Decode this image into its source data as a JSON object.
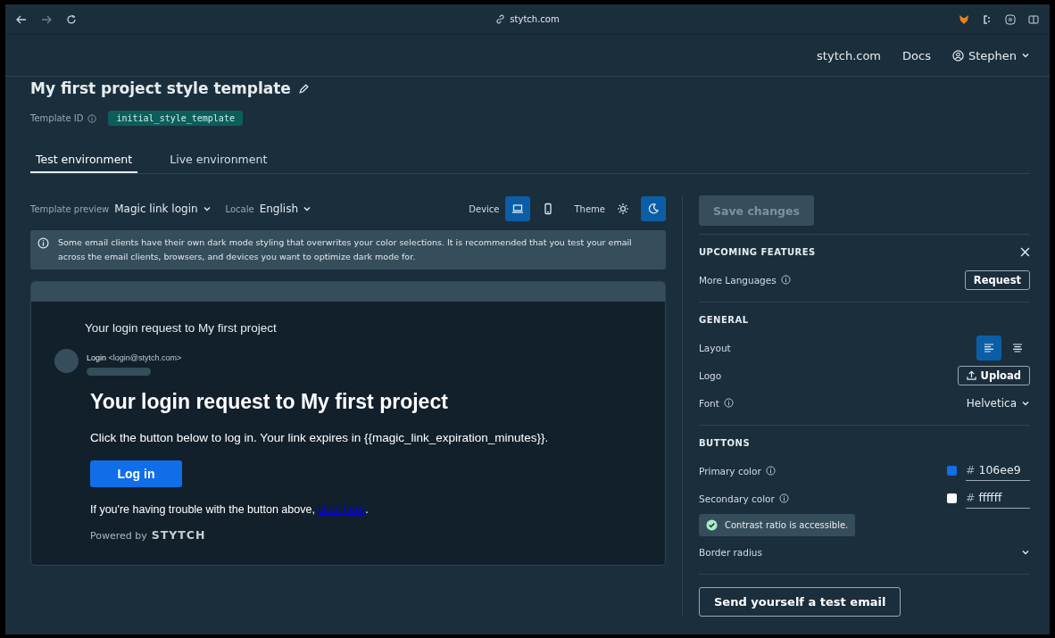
{
  "browser": {
    "url": "stytch.com"
  },
  "nav": {
    "links": [
      "stytch.com",
      "Docs"
    ],
    "user": "Stephen"
  },
  "title": "My first project style template",
  "template_id": {
    "label": "Template ID",
    "value": "initial_style_template"
  },
  "tabs": [
    {
      "label": "Test environment",
      "selected": true
    },
    {
      "label": "Live environment",
      "selected": false
    }
  ],
  "preview": {
    "template_label": "Template preview",
    "template_value": "Magic link login",
    "locale_label": "Locale",
    "locale_value": "English",
    "device_label": "Device",
    "devices": [
      {
        "kind": "laptop",
        "selected": true
      },
      {
        "kind": "phone",
        "selected": false
      }
    ],
    "theme_label": "Theme",
    "themes": [
      {
        "kind": "light",
        "selected": false
      },
      {
        "kind": "dark",
        "selected": true
      }
    ]
  },
  "notice": "Some email clients have their own dark mode styling that overwrites your color selections. It is recommended that you test your email across the email clients, browsers, and devices you want to optimize dark mode for.",
  "email": {
    "subject": "Your login request to My first project",
    "sender_name": "Login",
    "sender_email": "<login@stytch.com>",
    "heading": "Your login request to My first project",
    "body": "Click the button below to log in. Your link expires in {{magic_link_expiration_minutes}}.",
    "button": "Log in",
    "trouble_prefix": "If you're having trouble with the button above,",
    "trouble_link": "click here",
    "trouble_suffix": ".",
    "powered_by": "Powered by",
    "brand": "STYTCH"
  },
  "side": {
    "save": {
      "label": "Save changes",
      "disabled": true
    },
    "upcoming": {
      "heading": "UPCOMING FEATURES",
      "label": "More Languages",
      "button": "Request"
    },
    "general": {
      "heading": "GENERAL",
      "layout_label": "Layout",
      "layouts": [
        {
          "kind": "left",
          "selected": true
        },
        {
          "kind": "center",
          "selected": false
        }
      ],
      "logo_label": "Logo",
      "logo_button": "Upload",
      "font_label": "Font",
      "font_value": "Helvetica"
    },
    "buttons": {
      "heading": "BUTTONS",
      "colors": [
        {
          "label": "Primary color",
          "color": "#106ee9",
          "prefix": "#",
          "value": "106ee9"
        },
        {
          "label": "Secondary color",
          "color": "#ffffff",
          "prefix": "#",
          "value": "ffffff"
        }
      ],
      "contrast": "Contrast ratio is accessible.",
      "radius_label": "Border radius"
    },
    "test_button": "Send yourself a test email"
  }
}
